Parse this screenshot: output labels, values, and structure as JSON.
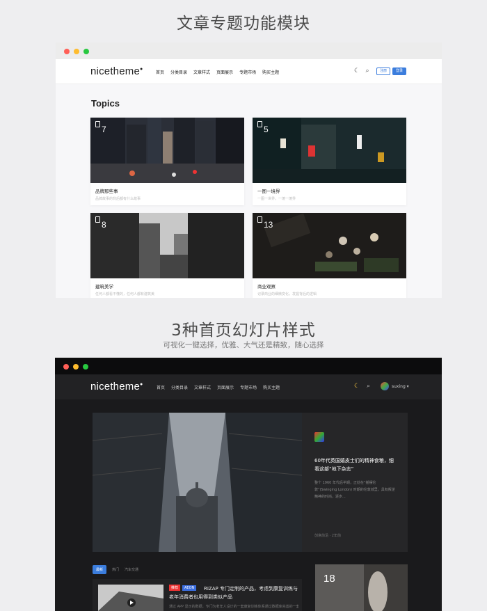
{
  "section1": {
    "title": "文章专题功能模块"
  },
  "section2": {
    "title": "3种首页幻灯片样式",
    "subtitle": "可视化一键选择，优雅、大气还是精致，随心选择"
  },
  "colors": {
    "accent": "#3b7ddd",
    "traffic": [
      "#ff5f57",
      "#febc2e",
      "#28c840"
    ]
  },
  "light": {
    "logo": "nicetheme",
    "menu": [
      "首页",
      "分类目录",
      "文章样式",
      "页面展示",
      "专题市场",
      "购买主题"
    ],
    "icons": [
      "moon-icon",
      "search-icon"
    ],
    "register": "注册",
    "login": "登录",
    "topics_title": "Topics",
    "cards": [
      {
        "count": "7",
        "title": "品牌那些事",
        "desc": "品牌故事的背后都有什么故事"
      },
      {
        "count": "5",
        "title": "一图一境界",
        "desc": "一图一世界，一境一境界"
      },
      {
        "count": "8",
        "title": "建筑美学",
        "desc": "任何人都看不懂的，任何人都有建筑美"
      },
      {
        "count": "13",
        "title": "商业观察",
        "desc": "记录商业的细微变化，发掘背后的逻辑"
      }
    ]
  },
  "dark": {
    "logo": "nicetheme",
    "menu": [
      "首页",
      "分类目录",
      "文章样式",
      "页面展示",
      "专题市场",
      "购买主题"
    ],
    "user": "suxing",
    "hero": {
      "title": "60年代英国嬉皮士们的精神食粮，细看这部“地下杂志”",
      "excerpt": "整个 1960 年代后半期，正处在“摇摆伦敦”(Swinging London) 时期的伦敦城里，具有叛逆精神的时尚，逐步...",
      "meta": "创意前沿  ·  2年前"
    },
    "tabs": [
      "最新",
      "热门",
      "汽车交通"
    ],
    "post": {
      "badges": [
        "推荐",
        "AEON"
      ],
      "title": "RIZAP 专门定制的产品，考虑到康复训练与老年消费者也用得到类似产品",
      "excerpt": "通过 APP 显示的数据，专门为老年人设计的一套康复训练体系通过数据库完善的一套训练"
    },
    "side_count": "18"
  }
}
